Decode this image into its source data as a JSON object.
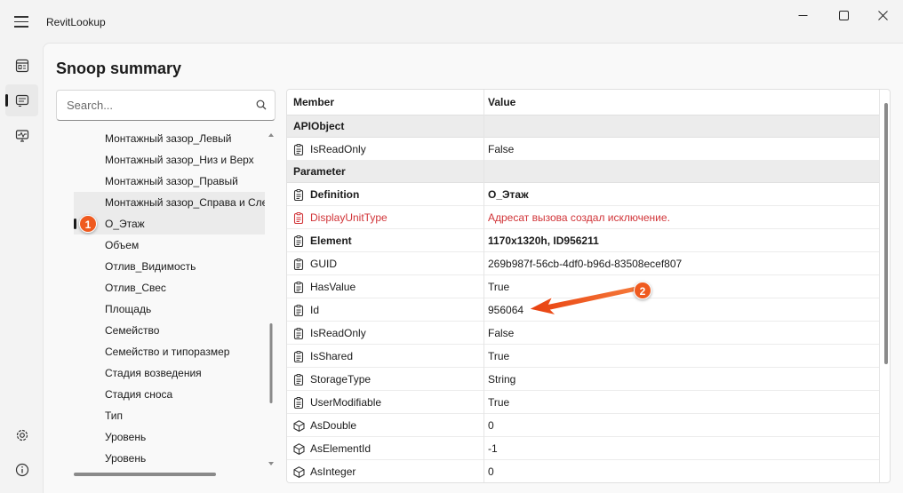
{
  "app": {
    "title": "RevitLookup"
  },
  "page": {
    "title": "Snoop summary"
  },
  "search": {
    "placeholder": "Search..."
  },
  "tree": {
    "items": [
      "Монтажный зазор_Левый",
      "Монтажный зазор_Низ и Верх",
      "Монтажный зазор_Правый",
      "Монтажный зазор_Справа и Слева",
      "О_Этаж",
      "Объем",
      "Отлив_Видимость",
      "Отлив_Свес",
      "Площадь",
      "Семейство",
      "Семейство и типоразмер",
      "Стадия возведения",
      "Стадия сноса",
      "Тип",
      "Уровень",
      "Уровень"
    ],
    "selected_index": 4
  },
  "grid": {
    "col_member": "Member",
    "col_value": "Value",
    "groups": [
      {
        "name": "APIObject",
        "rows": [
          {
            "member": "IsReadOnly",
            "value": "False",
            "icon": "property-icon"
          }
        ]
      },
      {
        "name": "Parameter",
        "rows": [
          {
            "member": "Definition",
            "value": "О_Этаж",
            "icon": "property-icon",
            "bold": true
          },
          {
            "member": "DisplayUnitType",
            "value": "Адресат вызова создал исключение.",
            "icon": "property-icon",
            "error": true
          },
          {
            "member": "Element",
            "value": "1170x1320h, ID956211",
            "icon": "property-icon",
            "bold": true
          },
          {
            "member": "GUID",
            "value": "269b987f-56cb-4df0-b96d-83508ecef807",
            "icon": "property-icon"
          },
          {
            "member": "HasValue",
            "value": "True",
            "icon": "property-icon"
          },
          {
            "member": "Id",
            "value": "956064",
            "icon": "property-icon"
          },
          {
            "member": "IsReadOnly",
            "value": "False",
            "icon": "property-icon"
          },
          {
            "member": "IsShared",
            "value": "True",
            "icon": "property-icon"
          },
          {
            "member": "StorageType",
            "value": "String",
            "icon": "property-icon"
          },
          {
            "member": "UserModifiable",
            "value": "True",
            "icon": "property-icon"
          },
          {
            "member": "AsDouble",
            "value": "0",
            "icon": "method-icon"
          },
          {
            "member": "AsElementId",
            "value": "-1",
            "icon": "method-icon"
          },
          {
            "member": "AsInteger",
            "value": "0",
            "icon": "method-icon"
          }
        ]
      }
    ]
  },
  "annotations": {
    "badge1": "1",
    "badge2": "2"
  },
  "colors": {
    "accent": "#ef5a1f",
    "error": "#d13438"
  }
}
